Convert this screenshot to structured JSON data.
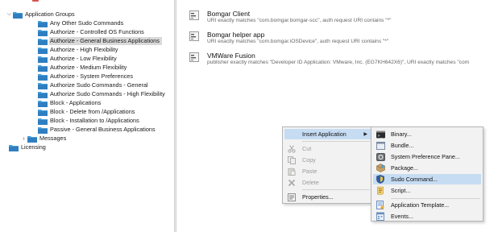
{
  "tree": {
    "items": [
      {
        "label": "Application Groups",
        "level": 0,
        "expanded": true
      },
      {
        "label": "Any Other Sudo Commands",
        "level": 1
      },
      {
        "label": "Authorize - Controlled OS Functions",
        "level": 1
      },
      {
        "label": "Authorize - General Business Applications",
        "level": 1,
        "selected": true
      },
      {
        "label": "Authorize - High Flexibility",
        "level": 1
      },
      {
        "label": "Authorize - Low Flexibility",
        "level": 1
      },
      {
        "label": "Authorize - Medium Flexibility",
        "level": 1
      },
      {
        "label": "Authorize - System Preferences",
        "level": 1
      },
      {
        "label": "Authorize Sudo Commands - General",
        "level": 1
      },
      {
        "label": "Authorize Sudo Commands - High Flexibility",
        "level": 1
      },
      {
        "label": "Block - Applications",
        "level": 1
      },
      {
        "label": "Block - Delete from /Applications",
        "level": 1
      },
      {
        "label": "Block - Installation to /Applications",
        "level": 1
      },
      {
        "label": "Passive - General Business Applications",
        "level": 1
      },
      {
        "label": "Messages",
        "level": 0,
        "expanded": false
      },
      {
        "label": "Licensing",
        "level": -1
      }
    ]
  },
  "rules": [
    {
      "title": "Bomgar Client",
      "description": "URI exactly matches \"com.bomgar.bomgar-scc\", auth request URI contains \"*\""
    },
    {
      "title": "Bomgar helper app",
      "description": "URI exactly matches \"com.bomgar.iOSDevice\", auth request URI contains \"*\""
    },
    {
      "title": "VMWare Fusion",
      "description": "publisher exactly matches \"Developer ID Application: VMware, Inc. (EG7KH642X6)\", URI exactly matches \"com"
    }
  ],
  "context_menu": {
    "items": [
      {
        "label": "Insert Application",
        "icon": "",
        "highlighted": true,
        "submenu": true
      },
      {
        "label": "Cut",
        "icon": "scissors-icon",
        "disabled": true
      },
      {
        "label": "Copy",
        "icon": "copy-icon",
        "disabled": true
      },
      {
        "label": "Paste",
        "icon": "paste-icon",
        "disabled": true
      },
      {
        "label": "Delete",
        "icon": "delete-icon",
        "disabled": true
      },
      {
        "label": "Properties...",
        "icon": "properties-icon",
        "disabled": false
      }
    ]
  },
  "submenu": {
    "items": [
      {
        "label": "Binary...",
        "icon": "terminal-icon"
      },
      {
        "label": "Bundle...",
        "icon": "bundle-icon"
      },
      {
        "label": "System Preference Pane...",
        "icon": "preference-pane-icon"
      },
      {
        "label": "Package...",
        "icon": "package-icon"
      },
      {
        "label": "Sudo Command...",
        "icon": "shield-icon",
        "highlighted": true
      },
      {
        "label": "Script...",
        "icon": "script-icon"
      },
      {
        "label": "Application Template...",
        "icon": "template-icon"
      },
      {
        "label": "Events...",
        "icon": "events-icon"
      }
    ]
  },
  "colors": {
    "folder": "#4a9fd8",
    "selection": "#d9d9d9",
    "menu_highlight": "#c6dcf3",
    "menu_bg": "#f2f2f2"
  }
}
